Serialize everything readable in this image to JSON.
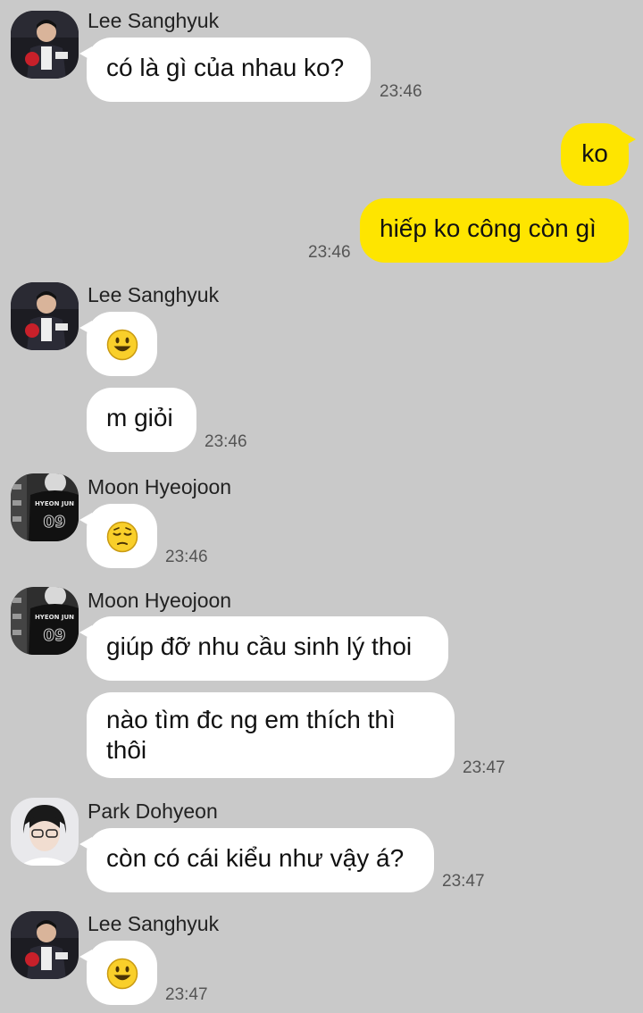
{
  "messages": {
    "m1": {
      "sender": "Lee Sanghyuk",
      "text": "có là gì của nhau ko?",
      "time": "23:46"
    },
    "m2": {
      "text": "ko"
    },
    "m3": {
      "text": "hiếp ko công còn gì",
      "time": "23:46"
    },
    "m4": {
      "sender": "Lee Sanghyuk",
      "emoji": "smiley-emoji"
    },
    "m5": {
      "text": "m giỏi",
      "time": "23:46"
    },
    "m6": {
      "sender": "Moon Hyeojoon",
      "emoji": "pensive-emoji",
      "time": "23:46"
    },
    "m7": {
      "sender": "Moon Hyeojoon",
      "text": "giúp đỡ nhu cầu sinh lý thoi"
    },
    "m8": {
      "text_line1": "nào tìm đc ng em thích thì",
      "text_line2": "thôi",
      "time": "23:47"
    },
    "m9": {
      "sender": "Park Dohyeon",
      "text": "còn có cái kiểu như vậy á?",
      "time": "23:47"
    },
    "m10": {
      "sender": "Lee Sanghyuk",
      "emoji": "smiley-emoji",
      "time": "23:47"
    }
  },
  "avatar_texts": {
    "jersey_name": "HYEON JUN",
    "jersey_number": "09"
  },
  "colors": {
    "background": "#c9c9c9",
    "incoming_bubble": "#ffffff",
    "outgoing_bubble": "#fee500",
    "emoji_yellow": "#f9cf2a"
  }
}
